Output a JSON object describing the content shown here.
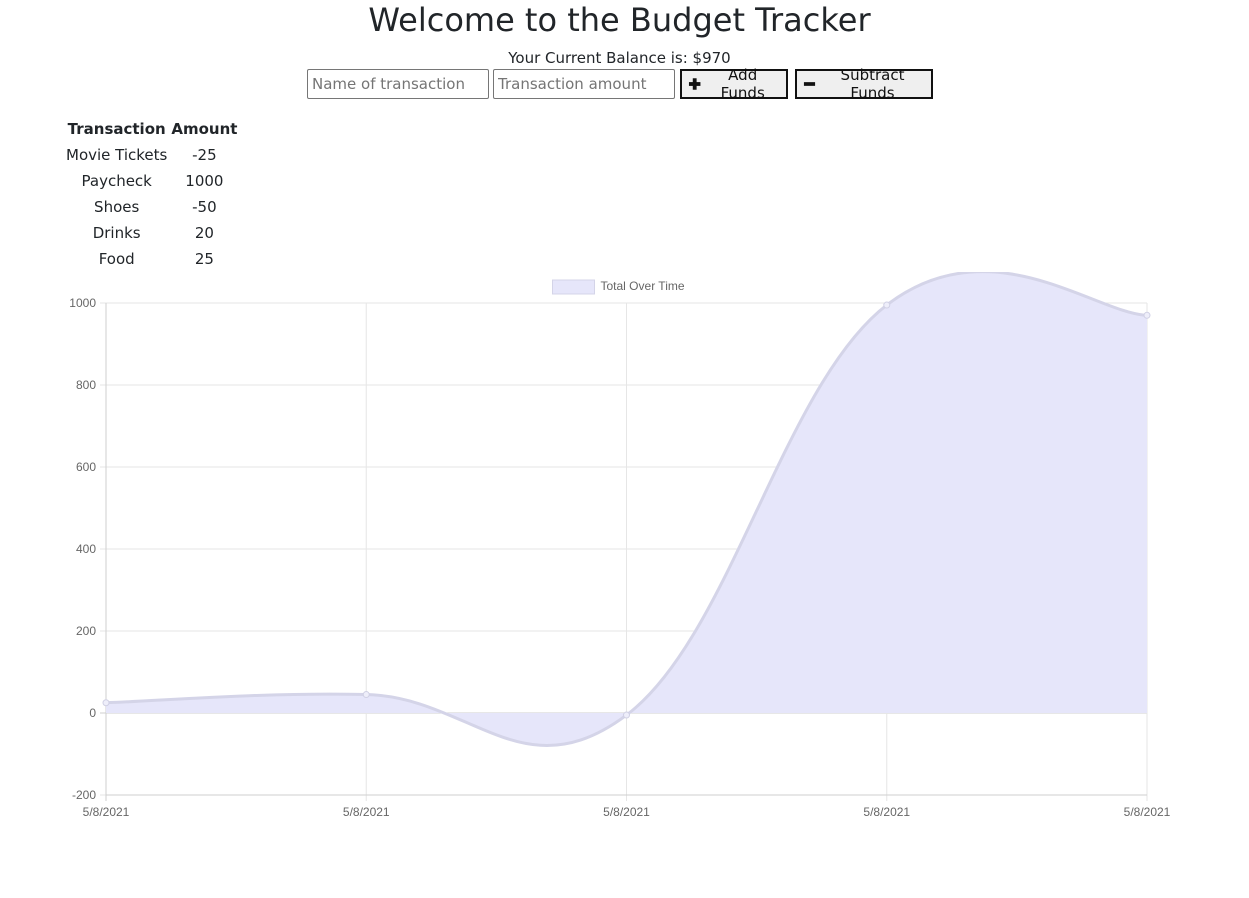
{
  "header": {
    "title": "Welcome to the Budget Tracker",
    "balance_label": "Your Current Balance is: $",
    "balance_value": "970"
  },
  "form": {
    "name_placeholder": "Name of transaction",
    "amount_placeholder": "Transaction amount",
    "add_label": "Add Funds",
    "subtract_label": "Subtract Funds",
    "add_icon": "plus-icon",
    "subtract_icon": "minus-icon"
  },
  "table": {
    "headers": [
      "Transaction",
      "Amount"
    ],
    "rows": [
      {
        "name": "Movie Tickets",
        "amount": "-25"
      },
      {
        "name": "Paycheck",
        "amount": "1000"
      },
      {
        "name": "Shoes",
        "amount": "-50"
      },
      {
        "name": "Drinks",
        "amount": "20"
      },
      {
        "name": "Food",
        "amount": "25"
      }
    ]
  },
  "chart_data": {
    "type": "area",
    "x": [
      "5/8/2021",
      "5/8/2021",
      "5/8/2021",
      "5/8/2021",
      "5/8/2021"
    ],
    "series": [
      {
        "name": "Total Over Time",
        "values": [
          25,
          45,
          -5,
          995,
          970
        ],
        "fill_color": "#e6e6fa",
        "stroke_color": "#d4d4e8"
      }
    ],
    "ylim": [
      -200,
      1000
    ],
    "yticks": [
      1000,
      800,
      600,
      400,
      200,
      0,
      -200
    ],
    "grid": true,
    "legend": "top-center"
  }
}
